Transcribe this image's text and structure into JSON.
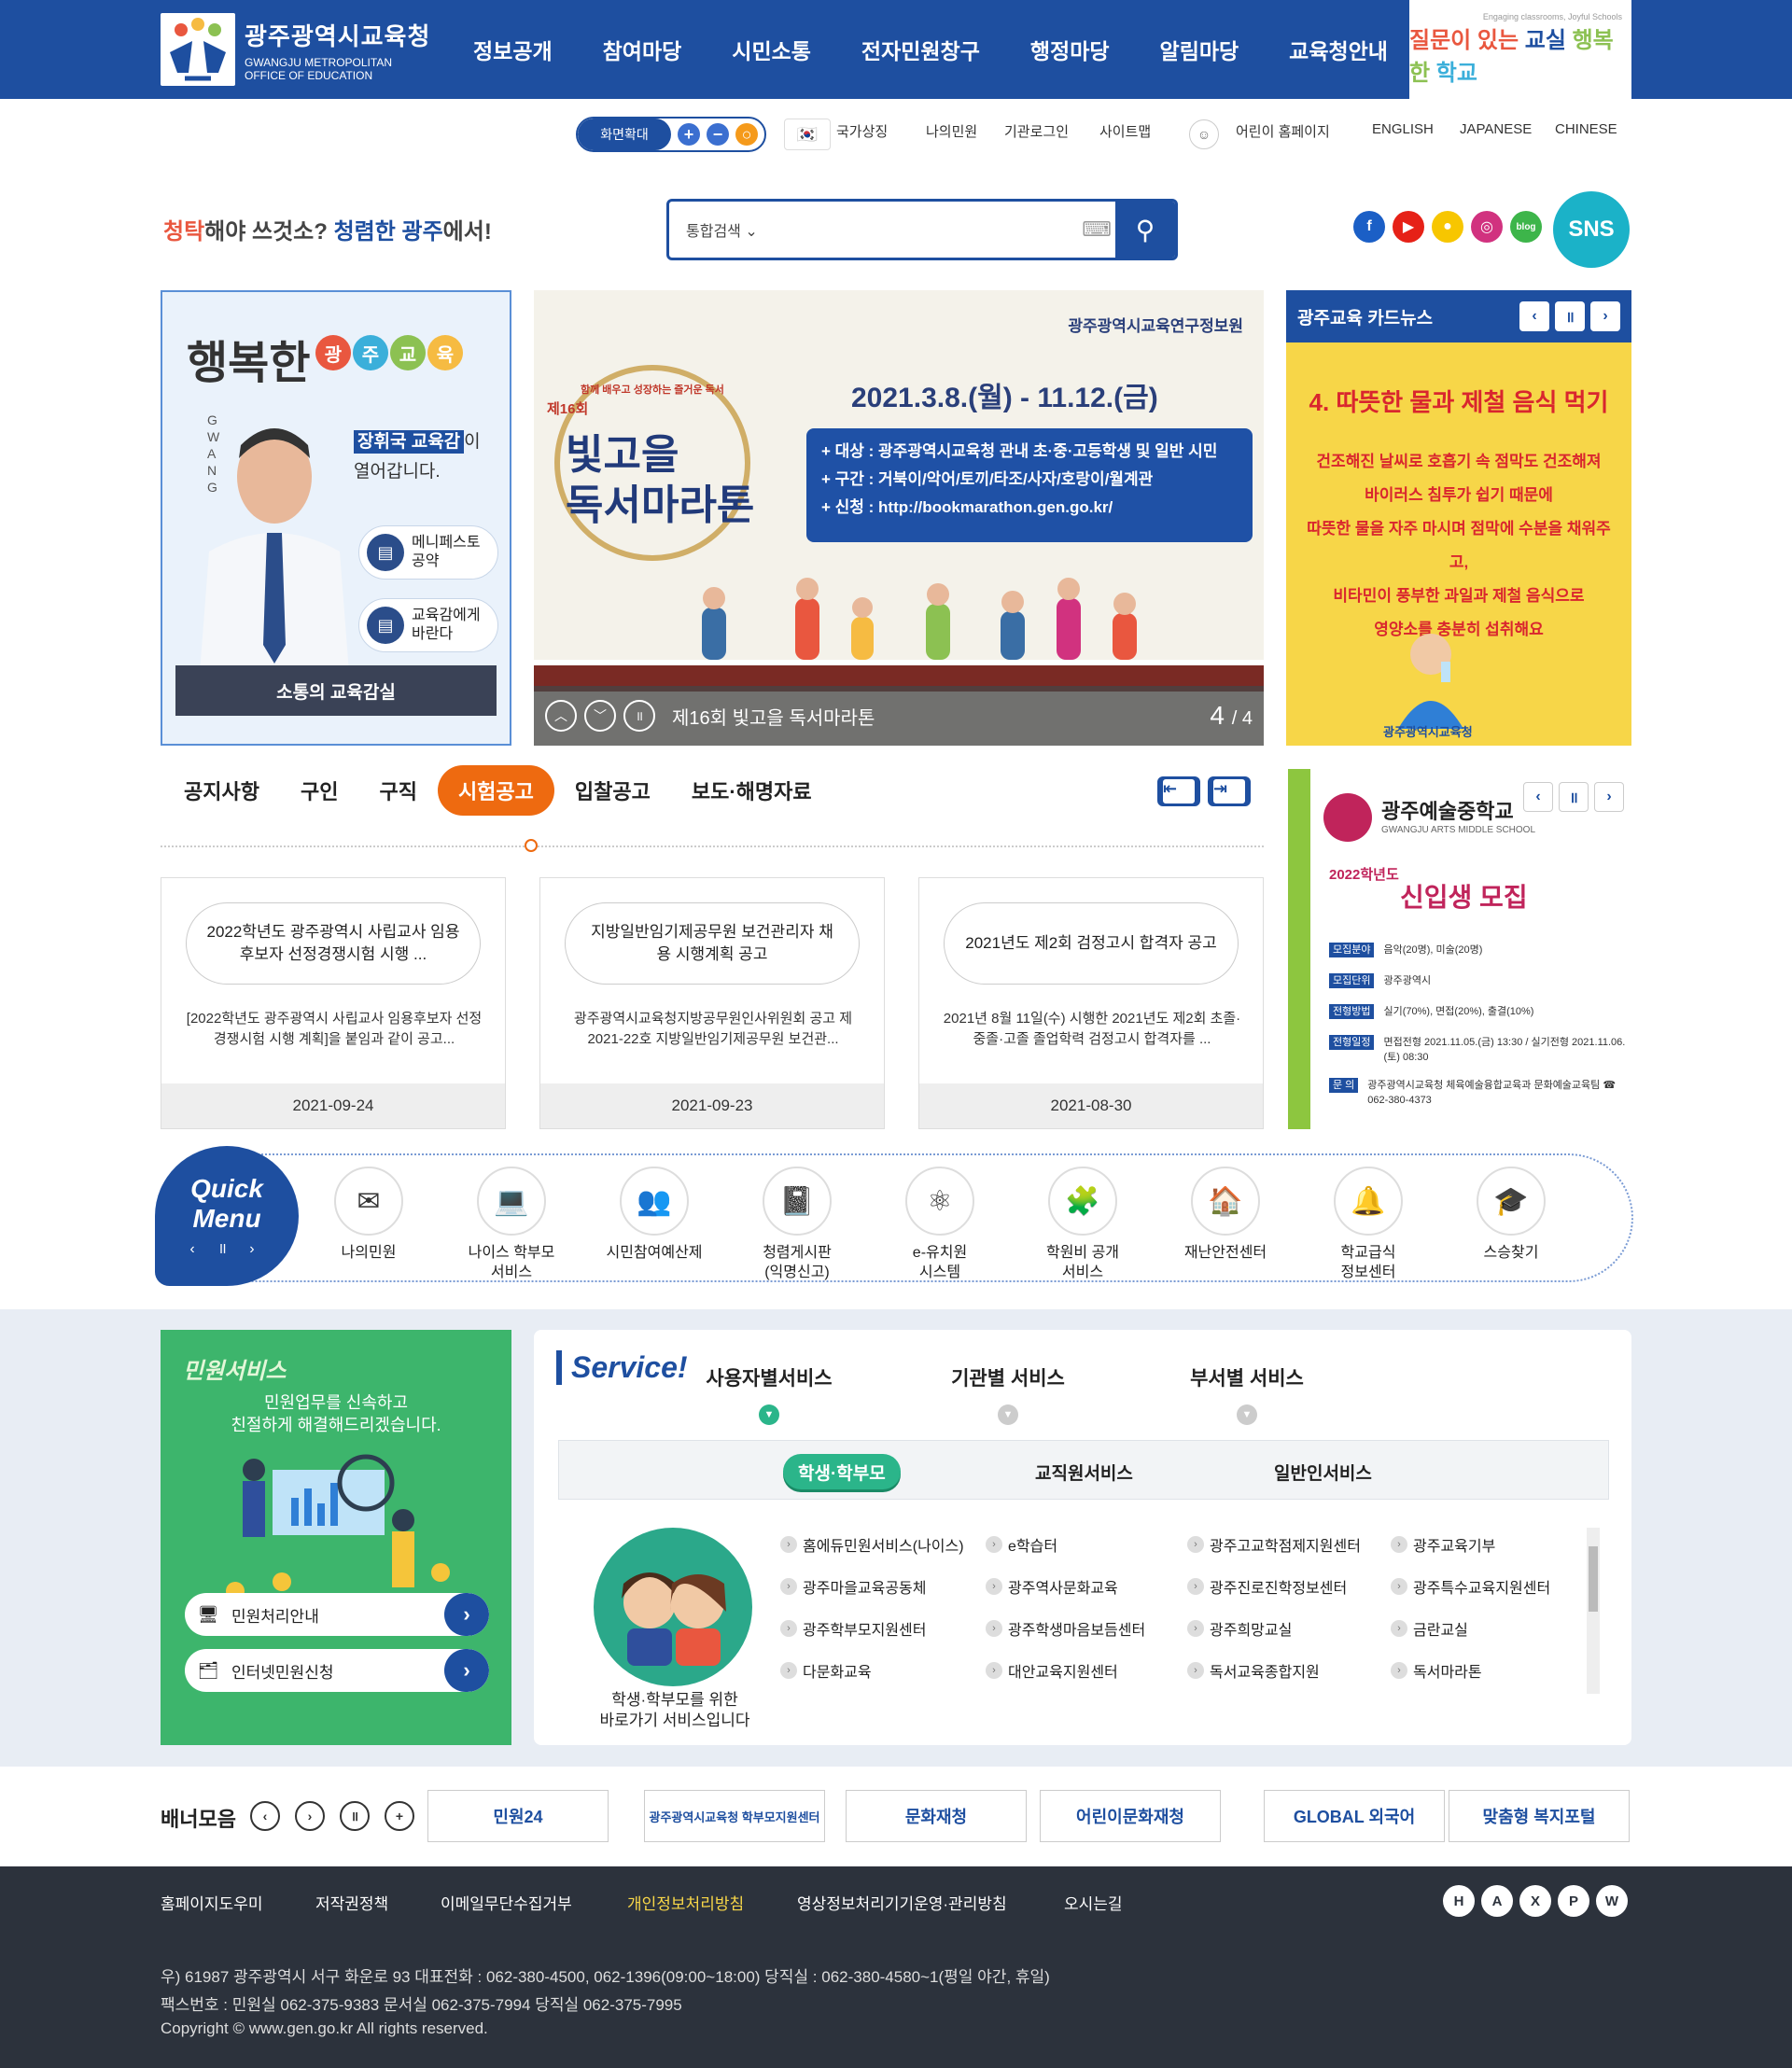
{
  "header": {
    "logo_title": "광주광역시교육청",
    "logo_sub1": "GWANGJU METROPOLITAN",
    "logo_sub2": "OFFICE OF EDUCATION",
    "nav": [
      "정보공개",
      "참여마당",
      "시민소통",
      "전자민원창구",
      "행정마당",
      "알림마당",
      "교육청안내"
    ],
    "slogan_small": "Engaging classrooms, Joyful Schools",
    "slogan_parts": [
      "질문이 있는 ",
      "교실",
      " 행복한 ",
      "학교"
    ]
  },
  "utility": {
    "zoom_label": "화면확대",
    "zoom_buttons": [
      "+",
      "−",
      "○"
    ],
    "links": [
      "국가상징",
      "나의민원",
      "기관로그인",
      "사이트맵",
      "어린이 홈페이지",
      "ENGLISH",
      "JAPANESE",
      "CHINESE"
    ]
  },
  "search": {
    "tagline_parts": [
      "청탁",
      "해야 쓰것소? ",
      "청렴한 광주",
      "에서!"
    ],
    "scope": "통합검색",
    "placeholder": ""
  },
  "sns": {
    "label": "SNS",
    "icons": [
      "facebook-icon",
      "youtube-icon",
      "kakao-icon",
      "instagram-icon",
      "blog-icon"
    ],
    "colors": [
      "#1b5fc6",
      "#e62117",
      "#f7c600",
      "#d1327f",
      "#3db54a"
    ]
  },
  "governor": {
    "title": "행복한",
    "title_chars": [
      "광",
      "주",
      "교",
      "육"
    ],
    "title_colors": [
      "#e9573f",
      "#3bafda",
      "#8cc152",
      "#f6bb42"
    ],
    "vertical_text": "GWANG",
    "name": "장휘국 교육감",
    "name_suffix": "이",
    "desc": "열어갑니다.",
    "btn1": [
      "메니페스토",
      "공약"
    ],
    "btn2": [
      "교육감에게",
      "바란다"
    ],
    "bar": "소통의 교육감실"
  },
  "main_slide": {
    "institute": "광주광역시교육연구정보원",
    "event_kicker": "함께 배우고 성장하는 즐거운 독서",
    "edition": "제16회",
    "event_title": [
      "빛고을",
      "독서마라톤"
    ],
    "dates": "2021.3.8.(월) - 11.12.(금)",
    "info": [
      "+ 대상 : 광주광역시교육청 관내 초·중·고등학생 및 일반 시민",
      "+ 구간 : 거북이/악어/토끼/타조/사자/호랑이/월계관",
      "+ 신청 : http://bookmarathon.gen.go.kr/"
    ],
    "caption": "제16회 빛고을 독서마라톤",
    "page_current": "4",
    "page_total": "/ 4"
  },
  "card_news": {
    "title": "광주교육 카드뉴스",
    "headline": "4. 따뜻한 물과 제철 음식 먹기",
    "body": [
      "건조해진 날씨로 호흡기 속 점막도 건조해져",
      "바이러스 침투가 쉽기 때문에",
      "따뜻한 물을 자주 마시며 점막에 수분을 채워주고,",
      "비타민이 풍부한 과일과 제철 음식으로",
      "영양소를 충분히 섭취해요"
    ],
    "footer": "광주광역시교육청"
  },
  "notice_tabs": [
    "공지사항",
    "구인",
    "구직",
    "시험공고",
    "입찰공고",
    "보도·해명자료"
  ],
  "notice_active": 3,
  "notices": [
    {
      "title": "2022학년도 광주광역시 사립교사 임용후보자 선정경쟁시험 시행 ...",
      "desc": "[2022학년도 광주광역시 사립교사 임용후보자 선정경쟁시험 시행 계획]을 붙임과 같이 공고...",
      "date": "2021-09-24"
    },
    {
      "title": "지방일반임기제공무원 보건관리자 채용 시행계획 공고",
      "desc": "광주광역시교육청지방공무원인사위원회 공고 제2021-22호 지방일반임기제공무원 보건관...",
      "date": "2021-09-23"
    },
    {
      "title": "2021년도 제2회 검정고시 합격자 공고",
      "desc": "2021년 8월 11일(수) 시행한 2021년도 제2회 초졸·중졸·고졸 졸업학력 검정고시 합격자를 ...",
      "date": "2021-08-30"
    }
  ],
  "promo": {
    "school": "광주예술중학교",
    "school_en": "GWANGJU ARTS MIDDLE SCHOOL",
    "year": "2022학년도",
    "headline": "신입생 모집",
    "rows": [
      [
        "모집분야",
        "음악(20명), 미술(20명)"
      ],
      [
        "모집단위",
        "광주광역시"
      ],
      [
        "전형방법",
        "실기(70%), 면접(20%), 출결(10%)"
      ],
      [
        "전형일정",
        "면접전형 2021.11.05.(금) 13:30 / 실기전형 2021.11.06.(토) 08:30"
      ],
      [
        "문 의",
        "광주광역시교육청 체육예술융합교육과 문화예술교육팀 ☎ 062-380-4373"
      ]
    ]
  },
  "quick_menu": {
    "title": [
      "Quick",
      "Menu"
    ],
    "controls": "‹ ॥ ›",
    "items": [
      {
        "label": "나의민원",
        "icon": "envelope-icon",
        "glyph": "✉"
      },
      {
        "label": "나이스 학부모\n서비스",
        "icon": "laptop-icon",
        "glyph": "💻"
      },
      {
        "label": "시민참여예산제",
        "icon": "people-icon",
        "glyph": "👥"
      },
      {
        "label": "청렴게시판\n(익명신고)",
        "icon": "notebook-icon",
        "glyph": "📓"
      },
      {
        "label": "e-유치원\n시스템",
        "icon": "atom-icon",
        "glyph": "⚛"
      },
      {
        "label": "학원비 공개\n서비스",
        "icon": "puzzle-icon",
        "glyph": "🧩"
      },
      {
        "label": "재난안전센터",
        "icon": "house-icon",
        "glyph": "🏠"
      },
      {
        "label": "학교급식\n정보센터",
        "icon": "bell-icon",
        "glyph": "🔔"
      },
      {
        "label": "스승찾기",
        "icon": "teacher-icon",
        "glyph": "🎓"
      }
    ]
  },
  "minwon": {
    "title": "민원서비스",
    "desc": [
      "민원업무를 신속하고",
      "친절하게 해결해드리겠습니다."
    ],
    "btn1": "민원처리안내",
    "btn2": "인터넷민원신청"
  },
  "service": {
    "logo": "Service!",
    "tabs": [
      "사용자별서비스",
      "기관별 서비스",
      "부서별 서비스"
    ],
    "subtabs": [
      "학생·학부모",
      "교직원서비스",
      "일반인서비스"
    ],
    "circle_desc": [
      "학생·학부모를 위한",
      "바로가기 서비스입니다"
    ],
    "links": [
      [
        "홈에듀민원서비스(나이스)",
        "e학습터",
        "광주고교학점제지원센터",
        "광주교육기부"
      ],
      [
        "광주마을교육공동체",
        "광주역사문화교육",
        "광주진로진학정보센터",
        "광주특수교육지원센터"
      ],
      [
        "광주학부모지원센터",
        "광주학생마음보듬센터",
        "광주희망교실",
        "금란교실"
      ],
      [
        "다문화교육",
        "대안교육지원센터",
        "독서교육종합지원",
        "독서마라톤"
      ]
    ]
  },
  "banners": {
    "title": "배너모음",
    "controls": [
      "‹",
      "›",
      "॥",
      "+"
    ],
    "items": [
      "민원24",
      "광주광역시교육청 학부모지원센터",
      "문화재청",
      "어린이문화재청",
      "GLOBAL 외국어",
      "맞춤형 복지포털"
    ]
  },
  "footer": {
    "links": [
      "홈페이지도우미",
      "저작권정책",
      "이메일무단수집거부",
      "개인정보처리방침",
      "영상정보처리기기운영·관리방침",
      "오시는길"
    ],
    "highlight": 3,
    "icons": [
      "H",
      "A",
      "X",
      "P",
      "W"
    ],
    "addr1": "우) 61987 광주광역시 서구 화운로 93   대표전화 : 062-380-4500, 062-1396(09:00~18:00)   당직실 : 062-380-4580~1(평일 야간, 휴일)",
    "addr2": "팩스번호 : 민원실 062-375-9383   문서실 062-375-7994   당직실 062-375-7995",
    "copyright": "Copyright © www.gen.go.kr All rights reserved."
  }
}
